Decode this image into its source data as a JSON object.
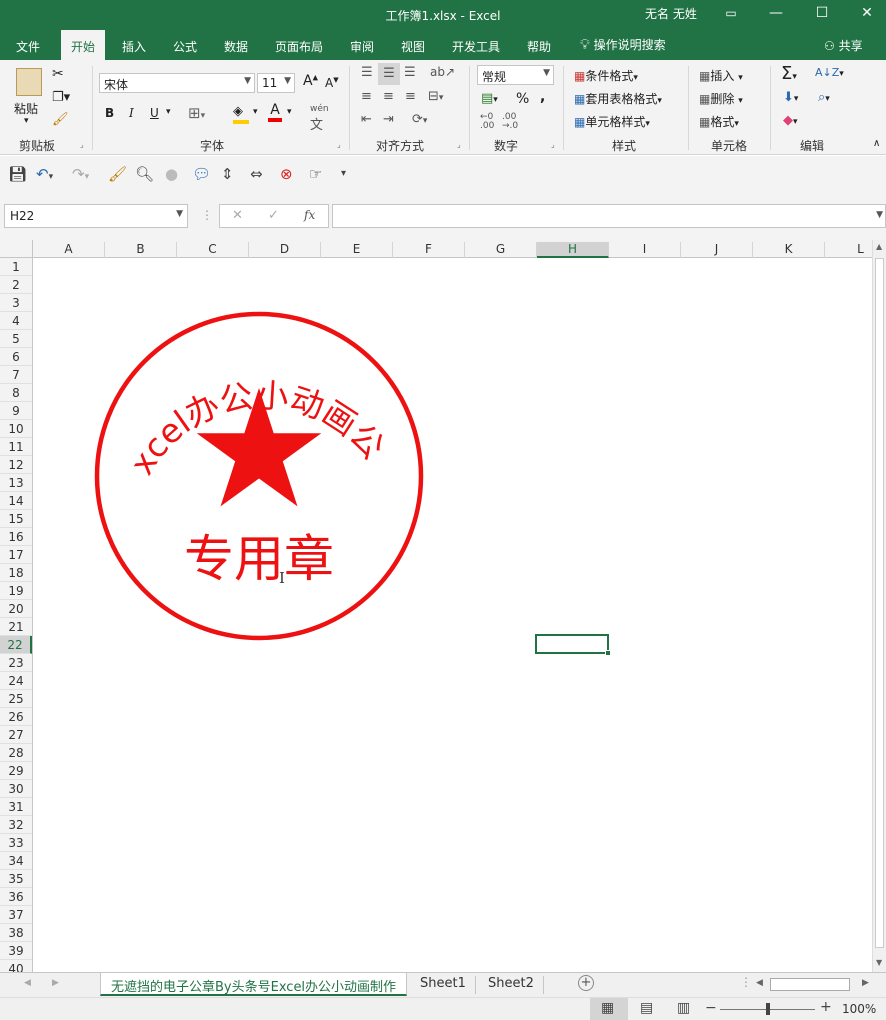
{
  "window": {
    "title": "工作簿1.xlsx  -  Excel",
    "user": "无名 无姓"
  },
  "tabs": [
    "文件",
    "开始",
    "插入",
    "公式",
    "数据",
    "页面布局",
    "审阅",
    "视图",
    "开发工具",
    "帮助"
  ],
  "tellme": "操作说明搜索",
  "share": "共享",
  "ribbon": {
    "clipboard": {
      "paste": "粘贴",
      "label": "剪贴板"
    },
    "font": {
      "name": "宋体",
      "size": "11",
      "label": "字体",
      "bold": "B",
      "italic": "I",
      "underline": "U"
    },
    "alignment": {
      "label": "对齐方式"
    },
    "number": {
      "format": "常规",
      "label": "数字",
      "percent": "%",
      "comma": ","
    },
    "styles": {
      "cond": "条件格式",
      "table": "套用表格格式",
      "cell": "单元格样式",
      "label": "样式"
    },
    "cells": {
      "insert": "插入",
      "delete": "删除",
      "format": "格式",
      "label": "单元格"
    },
    "editing": {
      "label": "编辑"
    }
  },
  "formula": {
    "namebox": "H22",
    "fx": "fx",
    "value": ""
  },
  "columns": [
    "A",
    "B",
    "C",
    "D",
    "E",
    "F",
    "G",
    "H",
    "I",
    "J",
    "K",
    "L"
  ],
  "rows": [
    "1",
    "2",
    "3",
    "4",
    "5",
    "6",
    "7",
    "8",
    "9",
    "10",
    "11",
    "12",
    "13",
    "14",
    "15",
    "16",
    "17",
    "18",
    "19",
    "20",
    "21",
    "22",
    "23",
    "24",
    "25",
    "26",
    "27",
    "28",
    "29",
    "30",
    "31",
    "32",
    "33",
    "34",
    "35",
    "36",
    "37",
    "38",
    "39",
    "40"
  ],
  "selected": {
    "column": "H",
    "row": "22"
  },
  "stamp": {
    "arc_text": "Excel办公小动画公司",
    "center_text": "专用章",
    "color": "#ee1111"
  },
  "sheets": [
    "无遮挡的电子公章By头条号Excel办公小动画制作",
    "Sheet1",
    "Sheet2"
  ],
  "active_sheet": "无遮挡的电子公章By头条号Excel办公小动画制作",
  "status": {
    "zoom": "100%"
  },
  "colors": {
    "accent": "#217346"
  }
}
